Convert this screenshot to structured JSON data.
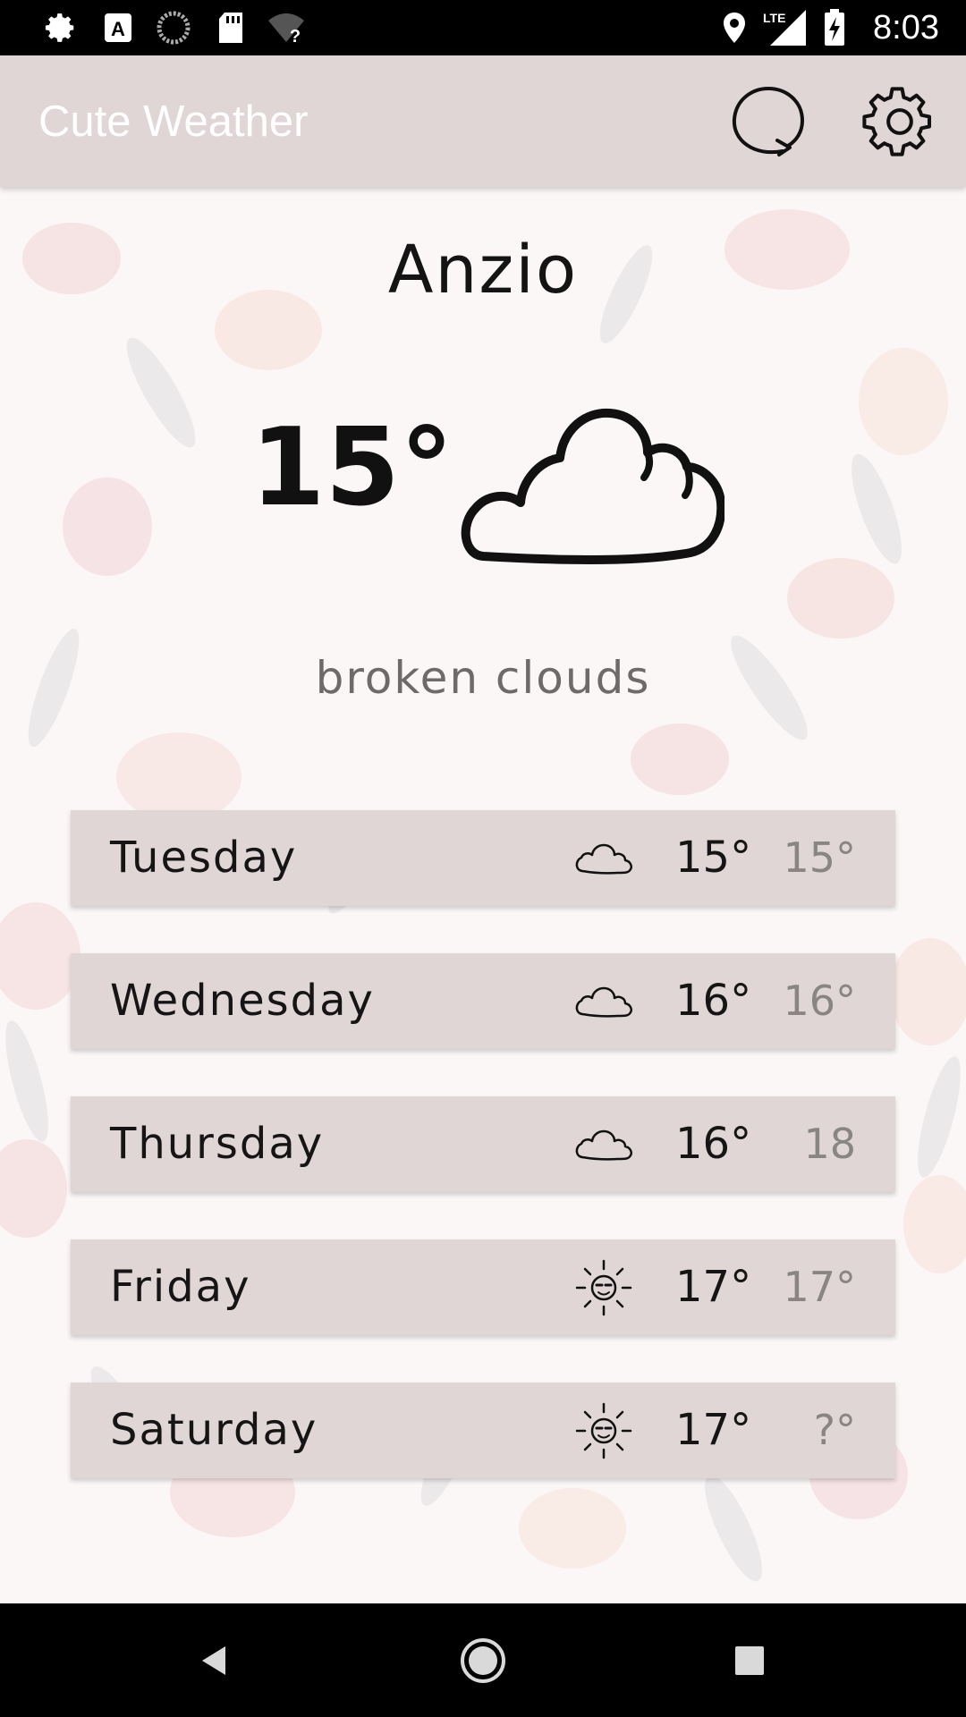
{
  "status_bar": {
    "time": "8:03",
    "network_label": "LTE",
    "icons": [
      "settings-icon",
      "a-notification-icon",
      "loading-icon",
      "sd-card-icon",
      "wifi-question-icon",
      "location-icon",
      "signal-icon",
      "battery-charging-icon"
    ]
  },
  "app_bar": {
    "title": "Cute Weather",
    "actions": [
      "refresh-icon",
      "gear-icon"
    ]
  },
  "current": {
    "city": "Anzio",
    "temperature": "15°",
    "icon": "cloud-icon",
    "description": "broken clouds"
  },
  "forecast": [
    {
      "day": "Tuesday",
      "icon": "cloud-icon",
      "high": "15°",
      "low": "15°"
    },
    {
      "day": "Wednesday",
      "icon": "cloud-icon",
      "high": "16°",
      "low": "16°"
    },
    {
      "day": "Thursday",
      "icon": "cloud-icon",
      "high": "16°",
      "low": "18"
    },
    {
      "day": "Friday",
      "icon": "sun-icon",
      "high": "17°",
      "low": "17°"
    },
    {
      "day": "Saturday",
      "icon": "sun-icon",
      "high": "17°",
      "low": "?°"
    }
  ],
  "nav_bar": {
    "buttons": [
      "back-icon",
      "home-icon",
      "recents-icon"
    ]
  },
  "colors": {
    "app_bar": "#e0d6d6",
    "row_background": "#e0d6d6",
    "title_text": "#ffffff",
    "description_text": "#6e6a6a",
    "low_temp_text": "#8a8585"
  }
}
